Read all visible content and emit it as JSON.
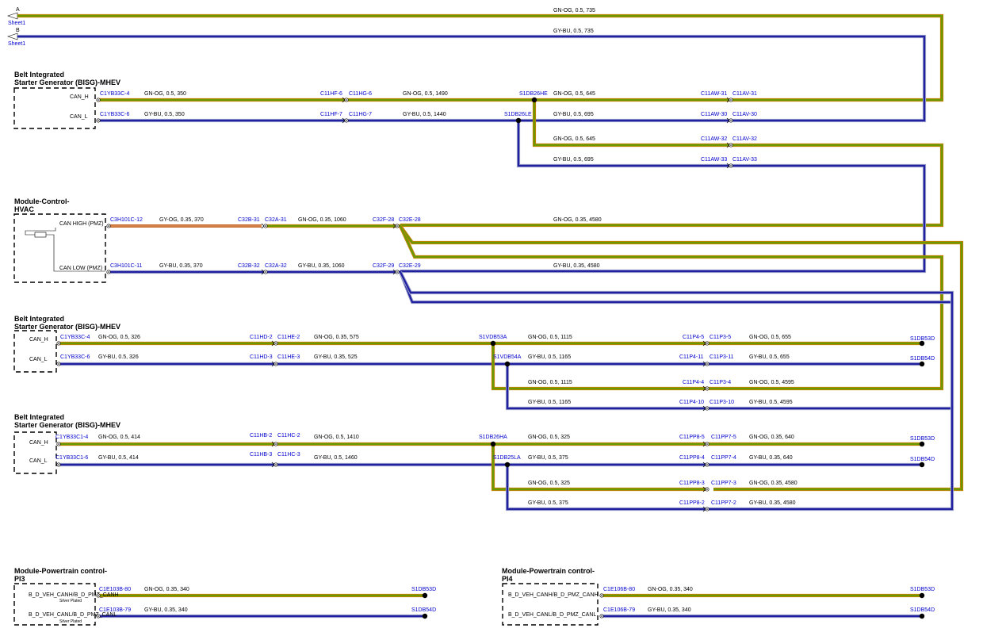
{
  "offsheet": {
    "a": {
      "letter": "A",
      "sheet": "Sheet1",
      "wire": "GN-OG,  0.5,  735"
    },
    "b": {
      "letter": "B",
      "sheet": "Sheet1",
      "wire": "GY-BU,  0.5,  735"
    }
  },
  "modules": {
    "bisg1": {
      "line1": "Belt Integrated",
      "line2": "Starter Generator (BISG)-MHEV",
      "pin_h": "CAN_H",
      "pin_l": "CAN_L"
    },
    "hvac": {
      "line1": "Module-Control-",
      "line2": "HVAC",
      "pin_h": "CAN HIGH (PMZ)",
      "pin_l": "CAN LOW (PMZ)"
    },
    "bisg2": {
      "line1": "Belt Integrated",
      "line2": "Starter Generator (BISG)-MHEV",
      "pin_h": "CAN_H",
      "pin_l": "CAN_L"
    },
    "bisg3": {
      "line1": "Belt Integrated",
      "line2": "Starter Generator (BISG)-MHEV",
      "pin_h": "CAN_H",
      "pin_l": "CAN_L"
    },
    "pcm3": {
      "line1": "Module-Powertrain control-",
      "line2": "PI3",
      "pin_h": "B_D_VEH_CANH/B_D_PMZ_CANH",
      "pin_l": "B_D_VEH_CANL/B_D_PMZ_CANL",
      "note": "Silver Plated"
    },
    "pcm4": {
      "line1": "Module-Powertrain control-",
      "line2": "PI4",
      "pin_h": "B_D_VEH_CANH/B_D_PMZ_CANH",
      "pin_l": "B_D_VEH_CANL/B_D_PMZ_CANL"
    }
  },
  "r1": {
    "h": {
      "c0": "C1YB33C-4",
      "w0": "GN-OG,  0.5,  350",
      "ca": "C11HF-6",
      "cb": "C11HG-6",
      "w1": "GN-OG,  0.5,  1490",
      "sp": "S1DB26HE",
      "w2": "GN-OG,  0.5,  645",
      "cc": "C11AW-31",
      "cd": "C11AV-31"
    },
    "l": {
      "c0": "C1YB33C-6",
      "w0": "GY-BU,  0.5,  350",
      "ca": "C11HF-7",
      "cb": "C11HG-7",
      "w1": "GY-BU,  0.5,  1440",
      "sp": "S1DB26LE",
      "w2": "GY-BU,  0.5,  695",
      "cc": "C11AW-30",
      "cd": "C11AV-30"
    },
    "bh": {
      "w": "GN-OG,  0.5,  645",
      "cc": "C11AW-32",
      "cd": "C11AV-32"
    },
    "bl": {
      "w": "GY-BU,  0.5,  695",
      "cc": "C11AW-33",
      "cd": "C11AV-33"
    }
  },
  "r2": {
    "h": {
      "c0": "C3H101C-12",
      "w0": "GY-OG,  0.35,  370",
      "ca": "C32B-31",
      "cb": "C32A-31",
      "w1": "GN-OG,  0.35,  1060",
      "cc": "C32F-28",
      "cd": "C32E-28",
      "w2": "GN-OG,  0.35,  4580"
    },
    "l": {
      "c0": "C3H101C-11",
      "w0": "GY-BU,  0.35,  370",
      "ca": "C32B-32",
      "cb": "C32A-32",
      "w1": "GY-BU,  0.35,  1060",
      "cc": "C32F-29",
      "cd": "C32E-29",
      "w2": "GY-BU,  0.35,  4580"
    }
  },
  "r3": {
    "h": {
      "c0": "C1YB33C-4",
      "w0": "GN-OG,  0.5,  326",
      "ca": "C11HD-2",
      "cb": "C11HE-2",
      "w1": "GN-OG,  0.35,  575",
      "sp": "S1VDB53A",
      "w2": "GN-OG,  0.5,  1115",
      "cc": "C11P4-5",
      "cd": "C11P3-5",
      "w3": "GN-OG,  0.5,  655",
      "end": "S1DB53D"
    },
    "l": {
      "c0": "C1YB33C-6",
      "w0": "GY-BU,  0.5,  326",
      "ca": "C11HD-3",
      "cb": "C11HE-3",
      "w1": "GY-BU,  0.35,  525",
      "sp": "S1VDB54A",
      "w2": "GY-BU,  0.5,  1165",
      "cc": "C11P4-11",
      "cd": "C11P3-11",
      "w3": "GY-BU,  0.5,  655",
      "end": "S1DB54D"
    },
    "bh": {
      "w": "GN-OG,  0.5,  1115",
      "cc": "C11P4-4",
      "cd": "C11P3-4",
      "w2": "GN-OG,  0.5,  4595"
    },
    "bl": {
      "w": "GY-BU,  0.5,  1165",
      "cc": "C11P4-10",
      "cd": "C11P3-10",
      "w2": "GY-BU,  0.5,  4595"
    }
  },
  "r4": {
    "h": {
      "c0": "C1YB33C1-4",
      "w0": "GN-OG,  0.5,  414",
      "ca": "C11HB-2",
      "cb": "C11HC-2",
      "w1": "GN-OG,  0.5,  1410",
      "sp": "S1DB26HA",
      "w2": "GN-OG,  0.5,  325",
      "cc": "C11PP8-5",
      "cd": "C11PP7-5",
      "w3": "GN-OG,  0.35,  640",
      "end": "S1DB53D"
    },
    "l": {
      "c0": "C1YB33C1-6",
      "w0": "GY-BU,  0.5,  414",
      "ca": "C11HB-3",
      "cb": "C11HC-3",
      "w1": "GY-BU,  0.5,  1460",
      "sp": "S1DB25LA",
      "w2": "GY-BU,  0.5,  375",
      "cc": "C11PP8-4",
      "cd": "C11PP7-4",
      "w3": "GY-BU,  0.35,  640",
      "end": "S1DB54D"
    },
    "bh": {
      "w": "GN-OG,  0.5,  325",
      "cc": "C11PP8-3",
      "cd": "C11PP7-3",
      "w2": "GN-OG,  0.35,  4580"
    },
    "bl": {
      "w": "GY-BU,  0.5,  375",
      "cc": "C11PP8-2",
      "cd": "C11PP7-2",
      "w2": "GY-BU,  0.35,  4580"
    }
  },
  "r5": {
    "h": {
      "c0": "C1E103B-80",
      "w0": "GN-OG,  0.35,  340",
      "end": "S1DB53D"
    },
    "l": {
      "c0": "C1E103B-79",
      "w0": "GY-BU,  0.35,  340",
      "end": "S1DB54D"
    }
  },
  "r6": {
    "h": {
      "c0": "C1E106B-80",
      "w0": "GN-OG,  0.35,  340",
      "end": "S1DB53D"
    },
    "l": {
      "c0": "C1E106B-79",
      "w0": "GY-BU,  0.35,  340",
      "end": "S1DB54D"
    }
  },
  "colors": {
    "gn_og_core": "#6a9a00",
    "gn_og_edge": "#c08000",
    "gy_bu_core": "#2020a0",
    "gy_bu_edge": "#9aa0c8",
    "gy_og_core": "#d98a50",
    "connector_text": "#0000cc"
  }
}
